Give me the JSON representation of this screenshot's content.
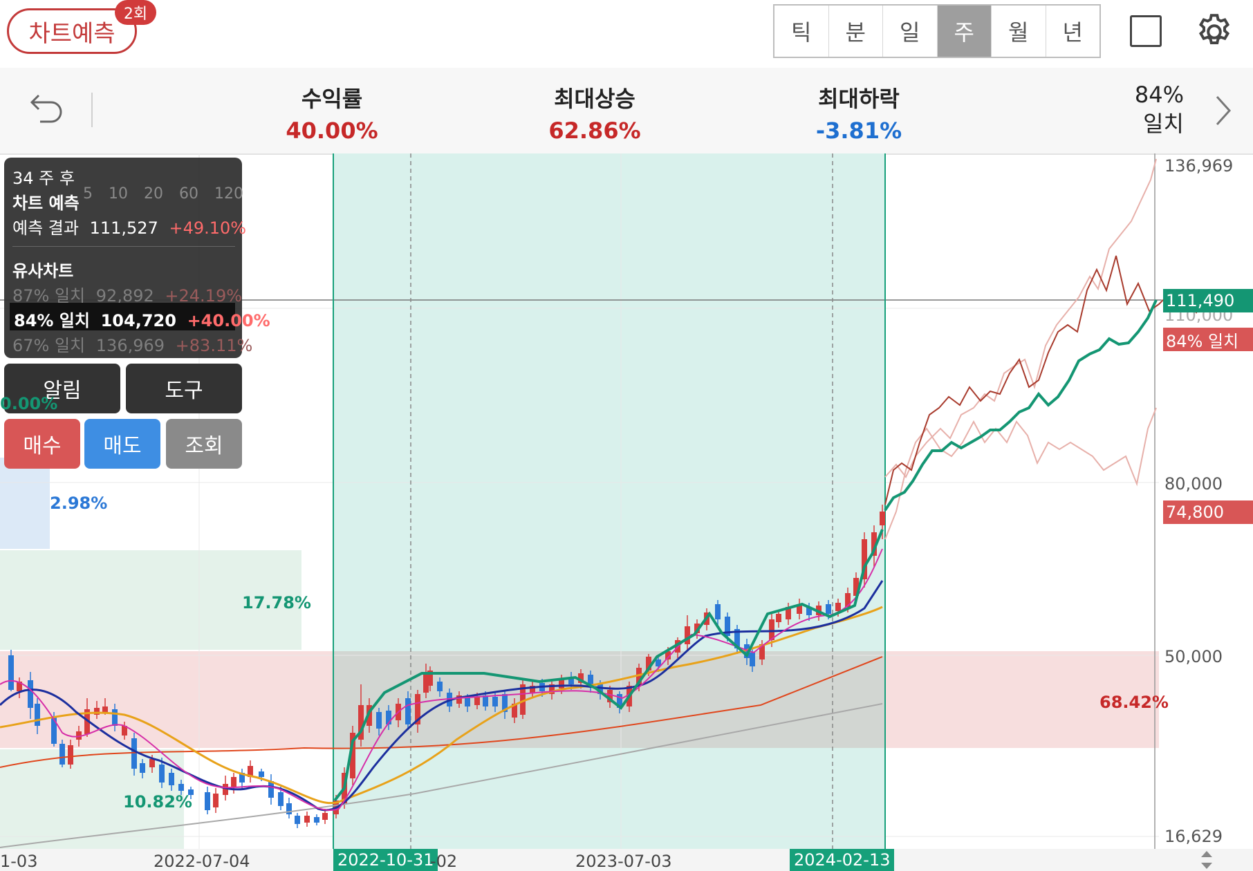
{
  "toolbar": {
    "predict_label": "차트예측",
    "predict_count": "2회",
    "periods": [
      {
        "label": "틱",
        "active": false
      },
      {
        "label": "분",
        "active": false
      },
      {
        "label": "일",
        "active": false
      },
      {
        "label": "주",
        "active": true
      },
      {
        "label": "월",
        "active": false
      },
      {
        "label": "년",
        "active": false
      }
    ]
  },
  "stats": {
    "return_label": "수익률",
    "return_value": "40.00%",
    "max_rise_label": "최대상승",
    "max_rise_value": "62.86%",
    "max_drop_label": "최대하락",
    "max_drop_value": "-3.81%",
    "match_pct": "84%",
    "match_label": "일치",
    "positive_color": "#c62828",
    "negative_color": "#1e6fd0"
  },
  "overlay": {
    "period": "34 주 후",
    "prediction_title": "차트 예측",
    "prediction_label": "예측 결과",
    "prediction_price": "111,527",
    "prediction_change": "+49.10%",
    "similar_title": "유사차트",
    "similar": [
      {
        "match": "87% 일치",
        "price": "92,892",
        "change": "+24.19%",
        "selected": false
      },
      {
        "match": "84% 일치",
        "price": "104,720",
        "change": "+40.00%",
        "selected": true
      },
      {
        "match": "67% 일치",
        "price": "136,969",
        "change": "+83.11%",
        "selected": false
      }
    ],
    "legend_fragments": [
      "5",
      "10",
      "20",
      "60",
      "120"
    ],
    "buttons": {
      "alarm": "알림",
      "tools": "도구",
      "buy": "매수",
      "sell": "매도",
      "inquiry": "조회"
    }
  },
  "chart": {
    "y_axis_labels": [
      "136,969",
      "80,000",
      "50,000",
      "16,629"
    ],
    "y_hidden_label": "110,000",
    "predicted_price_tag": "111,490",
    "current_price_tag": "74,800",
    "match_tag": "84% 일치",
    "x_axis_labels": [
      "1-03",
      "2022-07-04",
      "-02",
      "2023-07-03"
    ],
    "selected_start_date": "2022-10-31",
    "selected_end_date": "2024-02-13",
    "zone_percents": [
      "2.98%",
      "17.78%",
      "10.82%",
      "68.42%",
      "0.00%"
    ],
    "colors": {
      "up": "#d63c3c",
      "down": "#2b78d6",
      "ma5": "#d62ea8",
      "ma10": "#1c2f9e",
      "ma20": "#e8a21a",
      "ma60": "#e0461c",
      "ma120": "#a8a8a8",
      "prediction": "#149673"
    }
  }
}
